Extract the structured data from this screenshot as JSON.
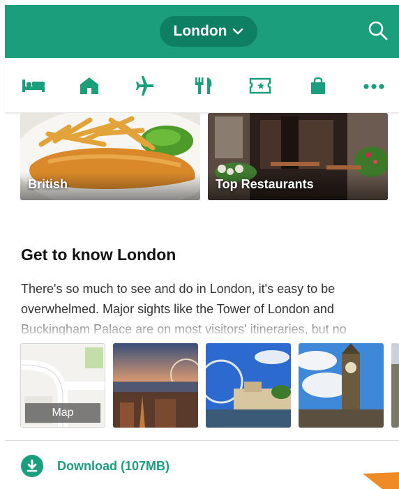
{
  "header": {
    "city": "London"
  },
  "categories": [
    {
      "icon": "bed-icon",
      "name": "hotels"
    },
    {
      "icon": "house-icon",
      "name": "rentals"
    },
    {
      "icon": "airplane-icon",
      "name": "flights"
    },
    {
      "icon": "fork-knife-icon",
      "name": "restaurants"
    },
    {
      "icon": "ticket-icon",
      "name": "attractions"
    },
    {
      "icon": "shopping-bag-icon",
      "name": "shopping"
    },
    {
      "icon": "more-icon",
      "name": "more"
    }
  ],
  "food_cards": [
    {
      "label": "British"
    },
    {
      "label": "Top Restaurants"
    }
  ],
  "section": {
    "title": "Get to know London",
    "text": "There's so much to see and do in London, it's easy to be overwhelmed. Major sights like the Tower of London and Buckingham Palace are on most visitors' itineraries, but no"
  },
  "thumbnails": {
    "map_label": "Map"
  },
  "download": {
    "label": "Download (107MB)"
  },
  "colors": {
    "brand": "#1a9e7b",
    "brand_dark": "#0f7f63",
    "accent_corner": "#f08a24"
  }
}
